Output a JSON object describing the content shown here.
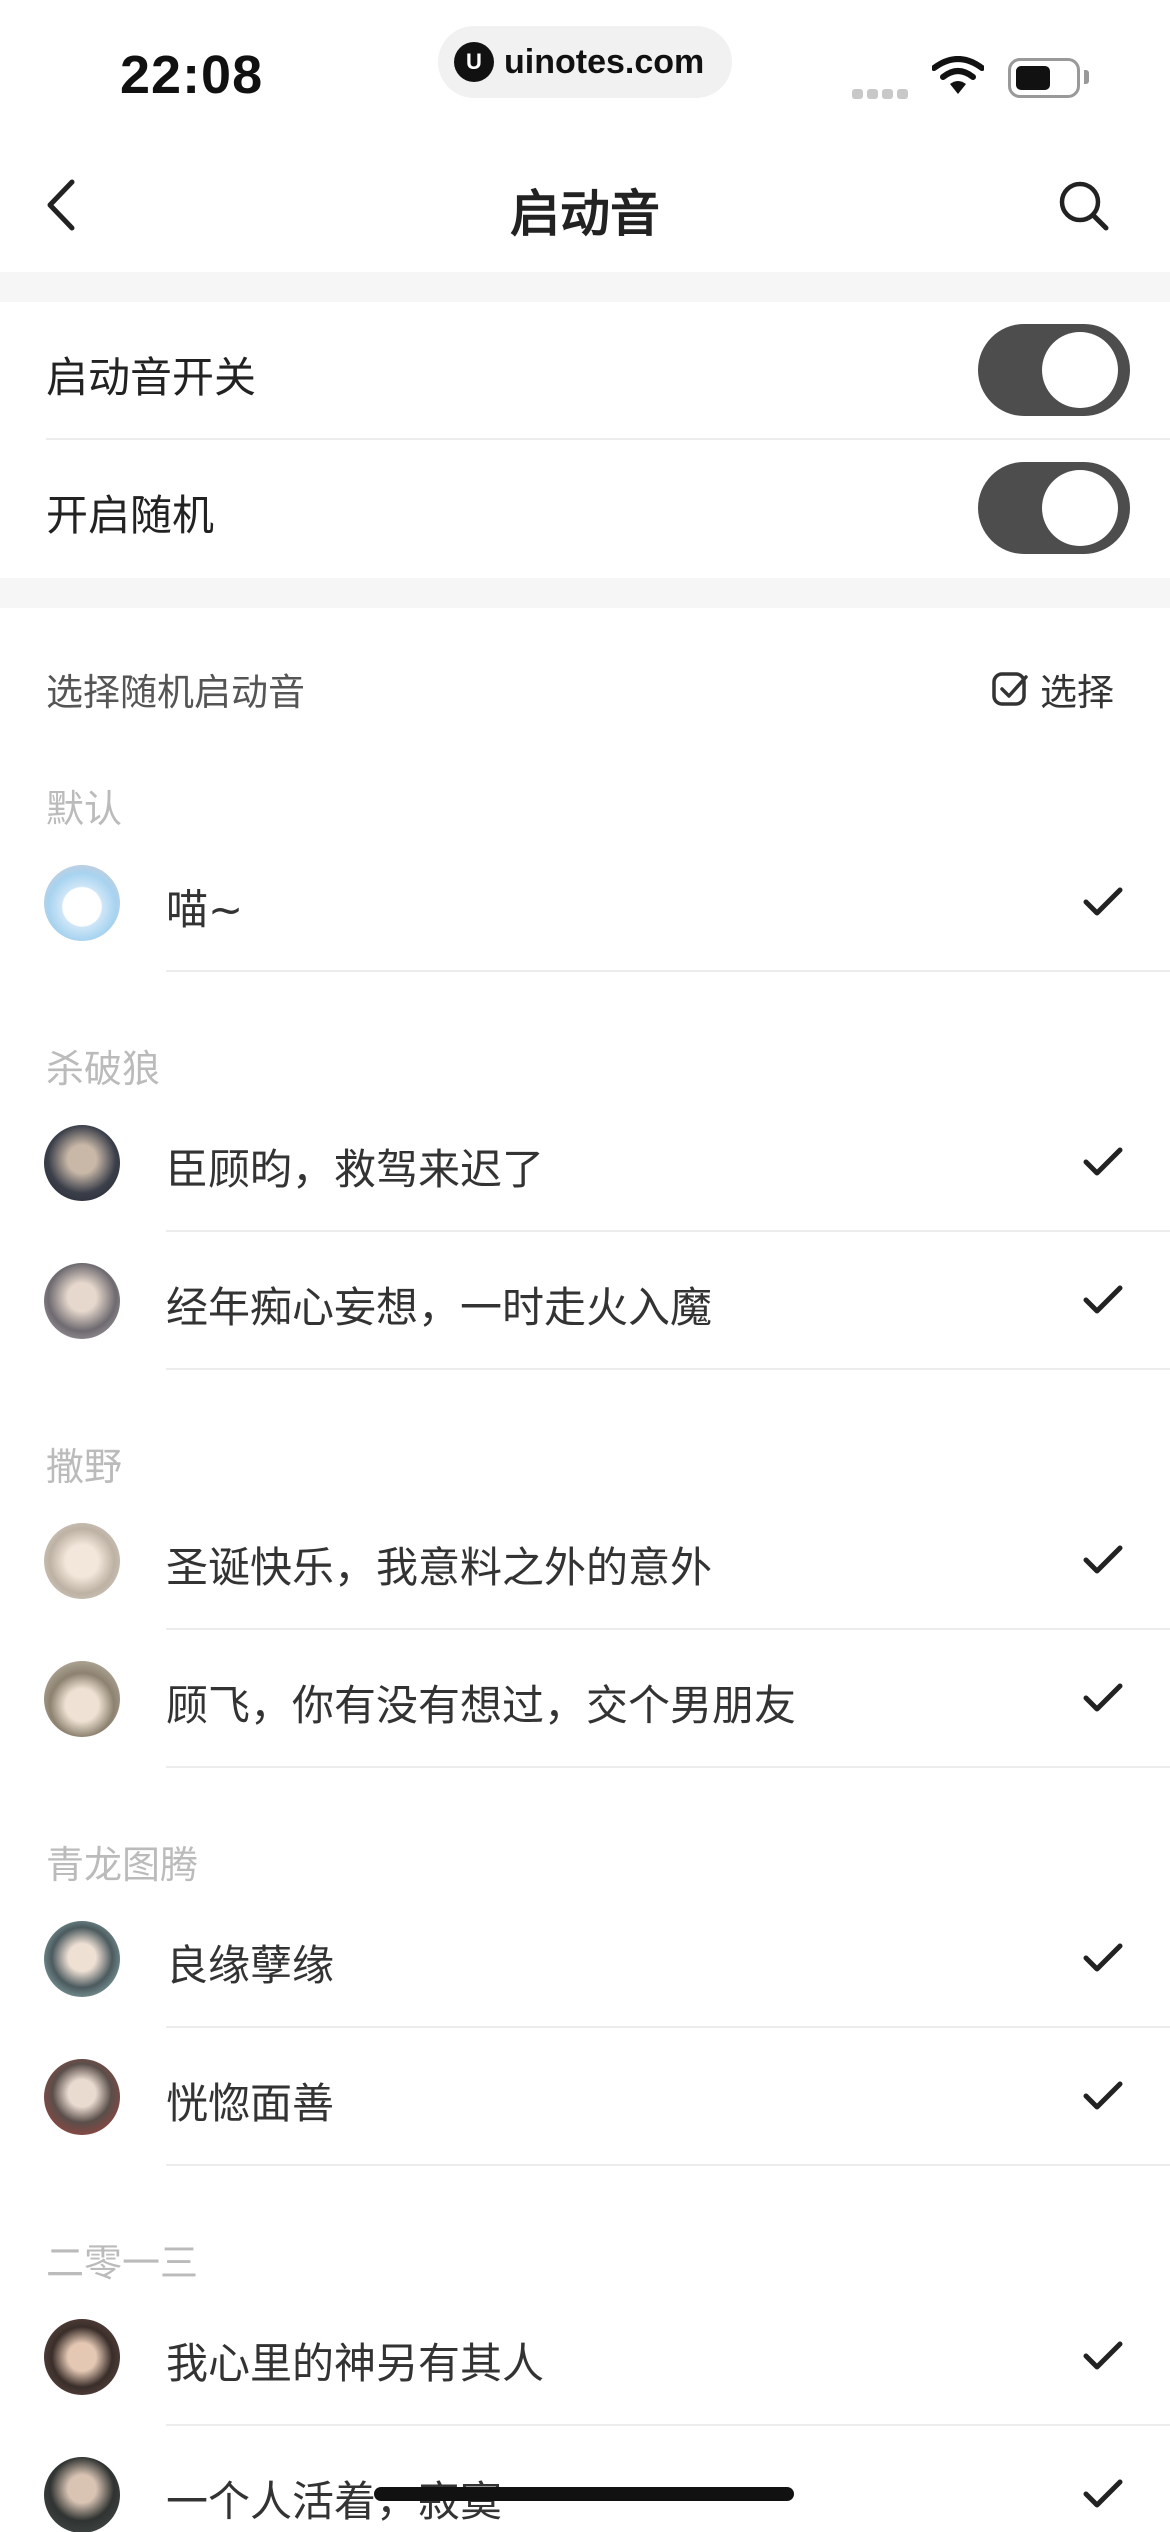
{
  "status_bar": {
    "time": "22:08",
    "url": "uinotes.com",
    "url_logo": "U"
  },
  "nav": {
    "title": "启动音"
  },
  "toggles": [
    {
      "label": "启动音开关",
      "on": true
    },
    {
      "label": "开启随机",
      "on": true
    }
  ],
  "select_section": {
    "label": "选择随机启动音",
    "select_button": "选择"
  },
  "groups": [
    {
      "title": "默认",
      "items": [
        {
          "label": "喵~",
          "checked": true,
          "avatar": "cat"
        }
      ]
    },
    {
      "title": "杀破狼",
      "items": [
        {
          "label": "臣顾昀，救驾来迟了",
          "checked": true,
          "avatar": "dark"
        },
        {
          "label": "经年痴心妄想，一时走火入魔",
          "checked": true,
          "avatar": "grey"
        }
      ]
    },
    {
      "title": "撒野",
      "items": [
        {
          "label": "圣诞快乐，我意料之外的意外",
          "checked": true,
          "avatar": "light"
        },
        {
          "label": "顾飞，你有没有想过，交个男朋友",
          "checked": true,
          "avatar": "cap"
        }
      ]
    },
    {
      "title": "青龙图腾",
      "items": [
        {
          "label": "良缘孽缘",
          "checked": true,
          "avatar": "teal"
        },
        {
          "label": "恍惚面善",
          "checked": true,
          "avatar": "red"
        }
      ]
    },
    {
      "title": "二零一三",
      "items": [
        {
          "label": "我心里的神另有其人",
          "checked": true,
          "avatar": "brown"
        },
        {
          "label": "一个人活着，寂寞",
          "checked": true,
          "avatar": "suit"
        }
      ]
    }
  ],
  "colors": {
    "switch_on": "#4d4d4d",
    "group_title": "#bbbbbb",
    "section_bg": "#f6f6f6"
  }
}
